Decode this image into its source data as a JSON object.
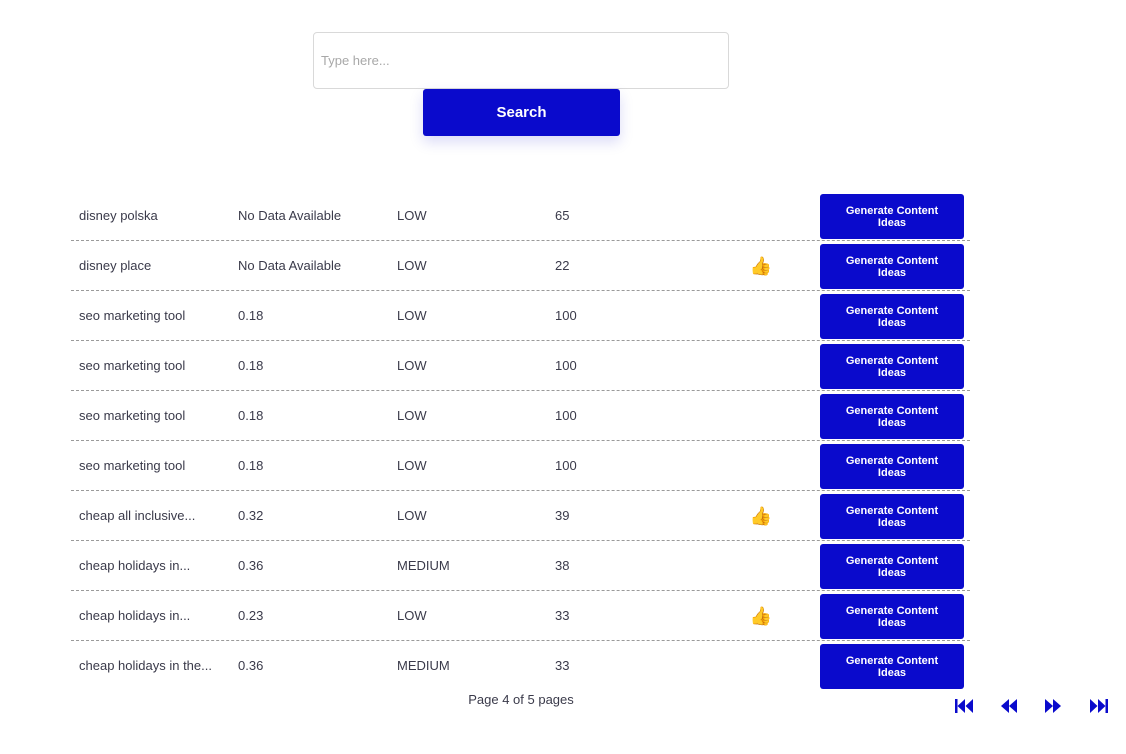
{
  "search": {
    "placeholder": "Type here...",
    "button_label": "Search"
  },
  "accent_color": "#0a0acc",
  "table": {
    "rows": [
      {
        "keyword": "disney polska",
        "cpc": "No Data Available",
        "competition": "LOW",
        "volume": "65",
        "thumb": "",
        "action_label": "Generate Content Ideas"
      },
      {
        "keyword": "disney place",
        "cpc": "No Data Available",
        "competition": "LOW",
        "volume": "22",
        "thumb": "👍",
        "action_label": "Generate Content Ideas"
      },
      {
        "keyword": "seo marketing tool",
        "cpc": "0.18",
        "competition": "LOW",
        "volume": "100",
        "thumb": "",
        "action_label": "Generate Content Ideas"
      },
      {
        "keyword": "seo marketing tool",
        "cpc": "0.18",
        "competition": "LOW",
        "volume": "100",
        "thumb": "",
        "action_label": "Generate Content Ideas"
      },
      {
        "keyword": "seo marketing tool",
        "cpc": "0.18",
        "competition": "LOW",
        "volume": "100",
        "thumb": "",
        "action_label": "Generate Content Ideas"
      },
      {
        "keyword": "seo marketing tool",
        "cpc": "0.18",
        "competition": "LOW",
        "volume": "100",
        "thumb": "",
        "action_label": "Generate Content Ideas"
      },
      {
        "keyword": "cheap all inclusive...",
        "cpc": "0.32",
        "competition": "LOW",
        "volume": "39",
        "thumb": "👍",
        "action_label": "Generate Content Ideas"
      },
      {
        "keyword": "cheap holidays in...",
        "cpc": "0.36",
        "competition": "MEDIUM",
        "volume": "38",
        "thumb": "",
        "action_label": "Generate Content Ideas"
      },
      {
        "keyword": "cheap holidays in...",
        "cpc": "0.23",
        "competition": "LOW",
        "volume": "33",
        "thumb": "👍",
        "action_label": "Generate Content Ideas"
      },
      {
        "keyword": "cheap holidays in the...",
        "cpc": "0.36",
        "competition": "MEDIUM",
        "volume": "33",
        "thumb": "",
        "action_label": "Generate Content Ideas"
      }
    ],
    "thumb_colors": [
      "",
      "#1fbf4a",
      "",
      "",
      "",
      "",
      "#f5a623",
      "",
      "#f5a623",
      ""
    ]
  },
  "pagination": {
    "text": "Page 4 of 5 pages",
    "icons": [
      "first-page-icon",
      "previous-page-icon",
      "next-page-icon",
      "last-page-icon"
    ]
  }
}
